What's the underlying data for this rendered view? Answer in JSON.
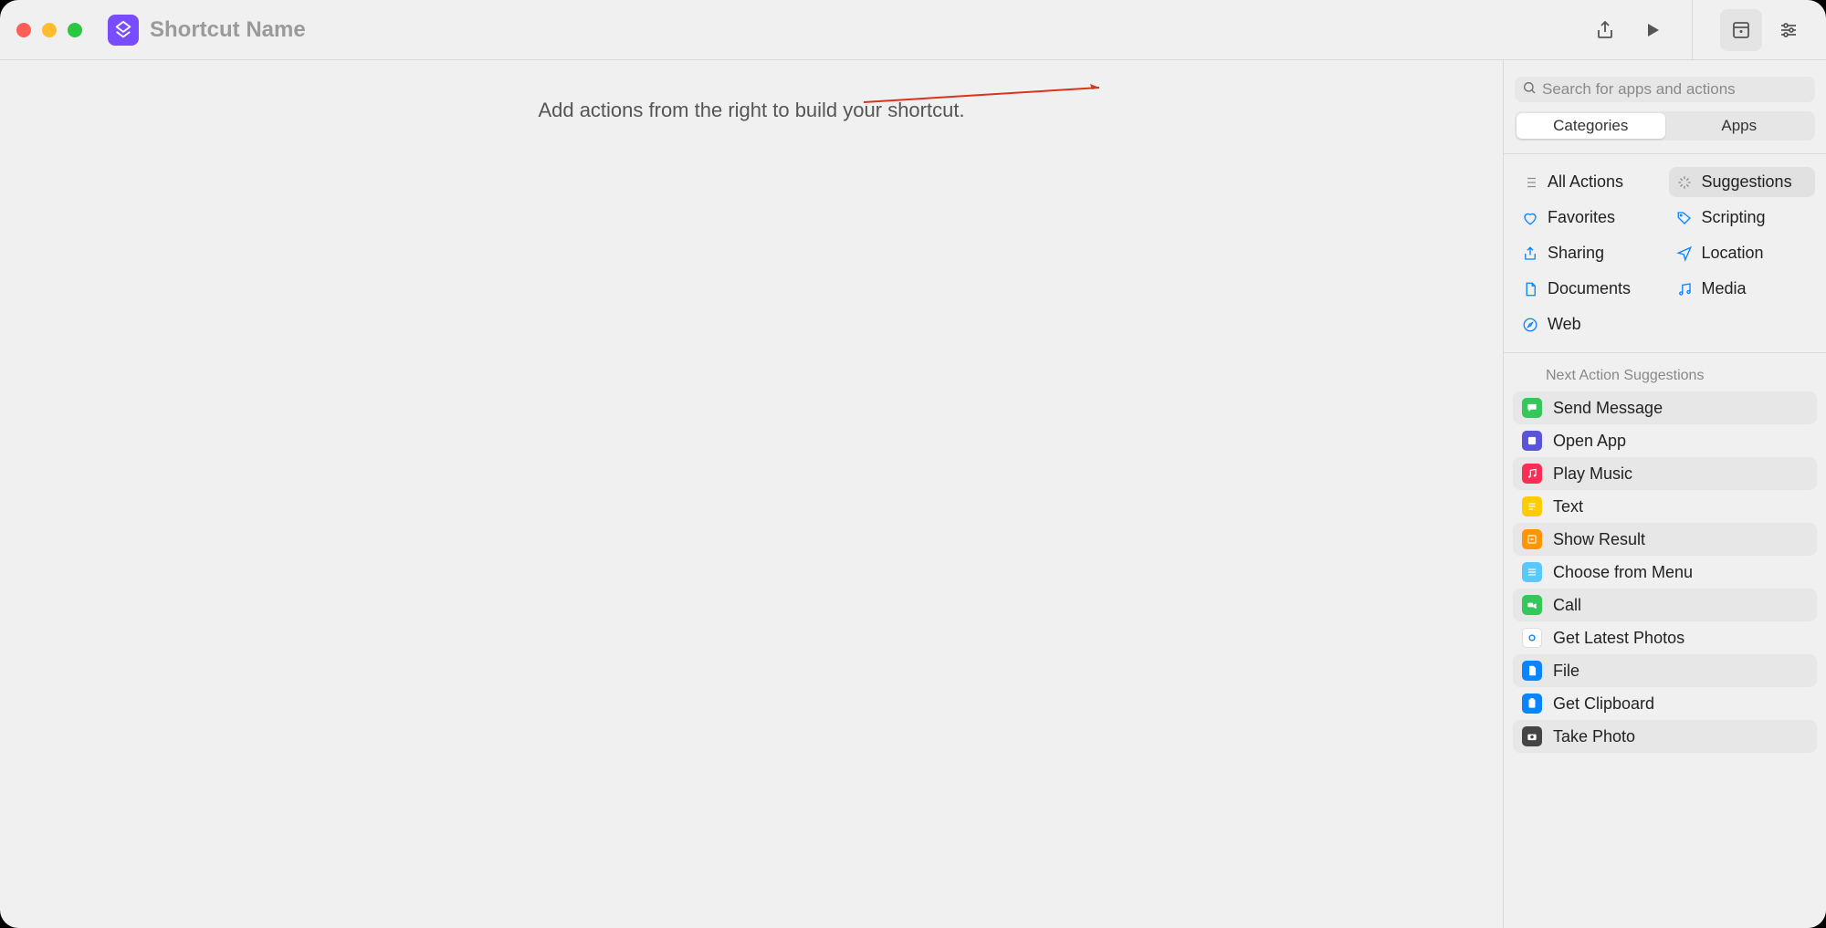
{
  "toolbar": {
    "title_placeholder": "Shortcut Name",
    "title_value": ""
  },
  "canvas": {
    "empty_text": "Add actions from the right to build your shortcut."
  },
  "search": {
    "placeholder": "Search for apps and actions",
    "value": ""
  },
  "tabs": {
    "categories": "Categories",
    "apps": "Apps",
    "active_index": 0
  },
  "categories": [
    {
      "id": "all-actions",
      "label": "All Actions",
      "icon": "list",
      "color": "#8e8e93",
      "selected": false
    },
    {
      "id": "suggestions",
      "label": "Suggestions",
      "icon": "sparkle",
      "color": "#8e8e93",
      "selected": true
    },
    {
      "id": "favorites",
      "label": "Favorites",
      "icon": "heart",
      "color": "#0a84ff",
      "selected": false
    },
    {
      "id": "scripting",
      "label": "Scripting",
      "icon": "tag",
      "color": "#0a84ff",
      "selected": false
    },
    {
      "id": "sharing",
      "label": "Sharing",
      "icon": "share",
      "color": "#0a84ff",
      "selected": false
    },
    {
      "id": "location",
      "label": "Location",
      "icon": "location",
      "color": "#0a84ff",
      "selected": false
    },
    {
      "id": "documents",
      "label": "Documents",
      "icon": "document",
      "color": "#0a84ff",
      "selected": false
    },
    {
      "id": "media",
      "label": "Media",
      "icon": "music",
      "color": "#0a84ff",
      "selected": false
    },
    {
      "id": "web",
      "label": "Web",
      "icon": "safari",
      "color": "#0a84ff",
      "selected": false
    }
  ],
  "suggestions_header": "Next Action Suggestions",
  "suggestions": [
    {
      "id": "send-message",
      "label": "Send Message",
      "icon": "message",
      "bg": "#34c759"
    },
    {
      "id": "open-app",
      "label": "Open App",
      "icon": "open-app",
      "bg": "#5856d6"
    },
    {
      "id": "play-music",
      "label": "Play Music",
      "icon": "music-app",
      "bg": "#ff2d55"
    },
    {
      "id": "text",
      "label": "Text",
      "icon": "text",
      "bg": "#ffcc00"
    },
    {
      "id": "show-result",
      "label": "Show Result",
      "icon": "result",
      "bg": "#ff9500"
    },
    {
      "id": "choose-menu",
      "label": "Choose from Menu",
      "icon": "menu",
      "bg": "#5ac8fa"
    },
    {
      "id": "call",
      "label": "Call",
      "icon": "facetime",
      "bg": "#34c759"
    },
    {
      "id": "latest-photos",
      "label": "Get Latest Photos",
      "icon": "photos",
      "bg": "#ffffff"
    },
    {
      "id": "file",
      "label": "File",
      "icon": "file",
      "bg": "#0a84ff"
    },
    {
      "id": "get-clipboard",
      "label": "Get Clipboard",
      "icon": "clipboard",
      "bg": "#0a84ff"
    },
    {
      "id": "take-photo",
      "label": "Take Photo",
      "icon": "camera",
      "bg": "#444444"
    }
  ]
}
